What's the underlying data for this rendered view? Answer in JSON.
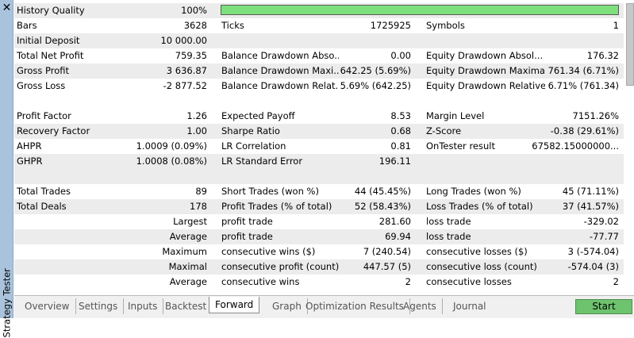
{
  "panel": {
    "title": "Strategy Tester"
  },
  "summary": {
    "history_quality_label": "History Quality",
    "history_quality_value": "100%",
    "history_quality_fraction": 1.0,
    "rows": [
      {
        "l1": "Bars",
        "v1": "3628",
        "l2": "Ticks",
        "v2": "1725925",
        "l3": "Symbols",
        "v3": "1"
      },
      {
        "l1": "Initial Deposit",
        "v1": "10 000.00",
        "l2": "",
        "v2": "",
        "l3": "",
        "v3": ""
      },
      {
        "l1": "Total Net Profit",
        "v1": "759.35",
        "l2": "Balance Drawdown Abso...",
        "v2": "0.00",
        "l3": "Equity Drawdown Absol...",
        "v3": "176.32"
      },
      {
        "l1": "Gross Profit",
        "v1": "3 636.87",
        "l2": "Balance Drawdown Maxi...",
        "v2": "642.25 (5.69%)",
        "l3": "Equity Drawdown Maximal",
        "v3": "761.34 (6.71%)"
      },
      {
        "l1": "Gross Loss",
        "v1": "-2 877.52",
        "l2": "Balance Drawdown Relat...",
        "v2": "5.69% (642.25)",
        "l3": "Equity Drawdown Relative",
        "v3": "6.71% (761.34)"
      }
    ],
    "rows2": [
      {
        "l1": "Profit Factor",
        "v1": "1.26",
        "l2": "Expected Payoff",
        "v2": "8.53",
        "l3": "Margin Level",
        "v3": "7151.26%"
      },
      {
        "l1": "Recovery Factor",
        "v1": "1.00",
        "l2": "Sharpe Ratio",
        "v2": "0.68",
        "l3": "Z-Score",
        "v3": "-0.38 (29.61%)"
      },
      {
        "l1": "AHPR",
        "v1": "1.0009 (0.09%)",
        "l2": "LR Correlation",
        "v2": "0.81",
        "l3": "OnTester result",
        "v3": "67582.15000000..."
      },
      {
        "l1": "GHPR",
        "v1": "1.0008 (0.08%)",
        "l2": "LR Standard Error",
        "v2": "196.11",
        "l3": "",
        "v3": ""
      }
    ],
    "rows3": [
      {
        "l1": "Total Trades",
        "v1": "89",
        "l2": "Short Trades (won %)",
        "v2": "44 (45.45%)",
        "l3": "Long Trades (won %)",
        "v3": "45 (71.11%)"
      },
      {
        "l1": "Total Deals",
        "v1": "178",
        "l2": "Profit Trades (% of total)",
        "v2": "52 (58.43%)",
        "l3": "Loss Trades (% of total)",
        "v3": "37 (41.57%)"
      },
      {
        "l1": "",
        "v1": "Largest",
        "l2": "profit trade",
        "v2": "281.60",
        "l3": "loss trade",
        "v3": "-329.02"
      },
      {
        "l1": "",
        "v1": "Average",
        "l2": "profit trade",
        "v2": "69.94",
        "l3": "loss trade",
        "v3": "-77.77"
      },
      {
        "l1": "",
        "v1": "Maximum",
        "l2": "consecutive wins ($)",
        "v2": "7 (240.54)",
        "l3": "consecutive losses ($)",
        "v3": "3 (-574.04)"
      },
      {
        "l1": "",
        "v1": "Maximal",
        "l2": "consecutive profit (count)",
        "v2": "447.57 (5)",
        "l3": "consecutive loss (count)",
        "v3": "-574.04 (3)"
      },
      {
        "l1": "",
        "v1": "Average",
        "l2": "consecutive wins",
        "v2": "2",
        "l3": "consecutive losses",
        "v3": "2"
      }
    ]
  },
  "tabs": [
    "Overview",
    "Settings",
    "Inputs",
    "Backtest",
    "Forward",
    "Graph",
    "Optimization Results",
    "Agents",
    "Journal"
  ],
  "active_tab": "Forward",
  "start_label": "Start",
  "colors": {
    "quality_bar": "#7de07d",
    "start_button": "#6ec36e",
    "sidebar": "#a9c3dd"
  }
}
